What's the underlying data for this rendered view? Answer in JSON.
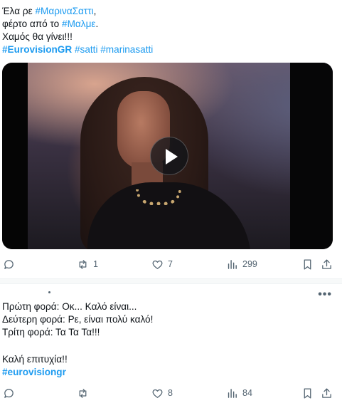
{
  "tweet1": {
    "text_lines": [
      {
        "plain": "Έλα ρε ",
        "tag": "#ΜαριναΣαττι",
        "tail": ","
      },
      {
        "plain": "φέρτο από το ",
        "tag": "#Μαλμε",
        "tail": "."
      },
      {
        "plain": "Χαμός θα γίνει!!!",
        "tag": "",
        "tail": ""
      }
    ],
    "hashtags_bold": "#EurovisionGR",
    "hashtags_rest": " #satti #marinasatti",
    "video": {
      "play_icon": "play-icon"
    },
    "actions": {
      "reply_count": "",
      "retweet_count": "1",
      "like_count": "7",
      "views_count": "299"
    }
  },
  "tweet2": {
    "more_icon": "•••",
    "text_lines": [
      "Πρώτη φορά: Οκ... Καλό είναι...",
      "Δεύτερη φορά: Ρε, είναι πολύ καλό!",
      "Τρίτη φορά: Τα Τα Τα!!!",
      "",
      "Καλή επιτυχία!!"
    ],
    "hashtag": "#eurovisiongr",
    "actions": {
      "reply_count": "",
      "retweet_count": "",
      "like_count": "8",
      "views_count": "84"
    }
  },
  "colors": {
    "accent": "#1d9bf0",
    "icon": "#536471",
    "text": "#0f1419"
  }
}
